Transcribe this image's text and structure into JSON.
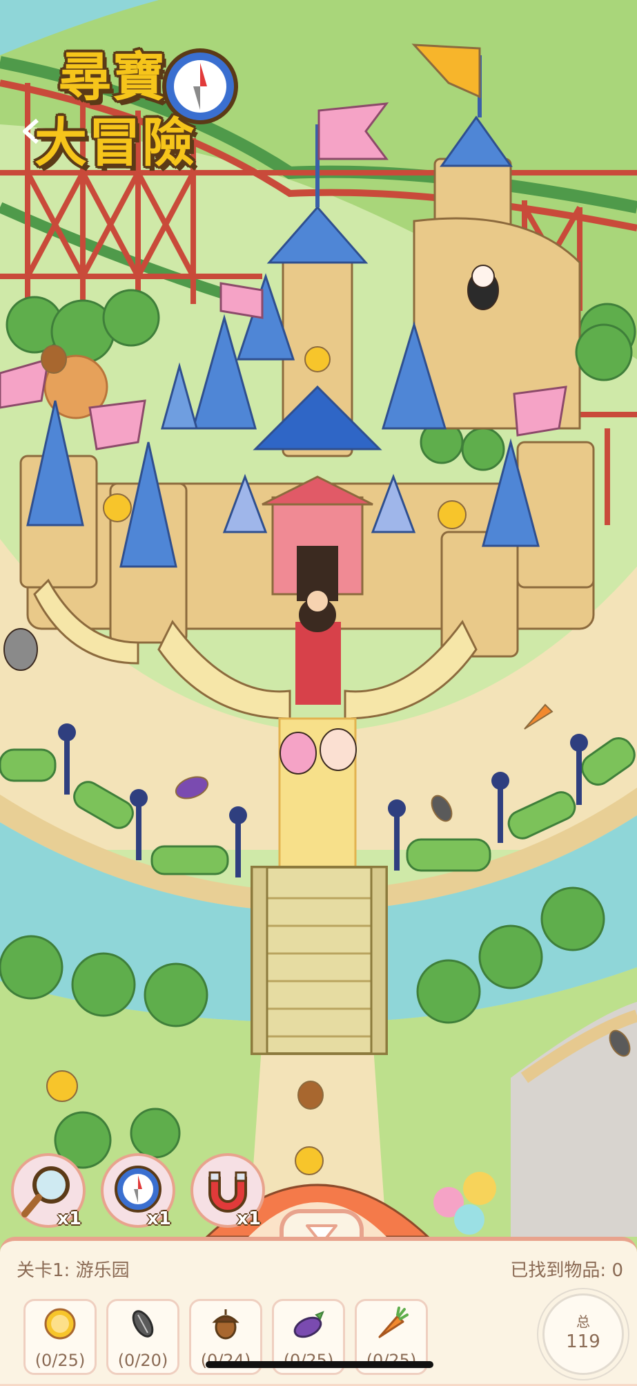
{
  "logo": {
    "line1": "尋寶",
    "line2": "大冒險"
  },
  "tools": [
    {
      "name": "magnifier",
      "count": "x1"
    },
    {
      "name": "compass",
      "count": "x1"
    },
    {
      "name": "magnet",
      "count": "x1"
    }
  ],
  "panel": {
    "level": "关卡1: 游乐园",
    "found": "已找到物品: 0",
    "items": [
      {
        "icon": "coin-icon",
        "progress": "(0/25)"
      },
      {
        "icon": "sunflower-seed-icon",
        "progress": "(0/20)"
      },
      {
        "icon": "acorn-icon",
        "progress": "(0/24)"
      },
      {
        "icon": "eggplant-icon",
        "progress": "(0/25)"
      },
      {
        "icon": "carrot-icon",
        "progress": "(0/25)"
      }
    ],
    "total_label": "总",
    "total_value": "119"
  },
  "colors": {
    "grass": "#cfe9a8",
    "water": "#8fd6d8",
    "path": "#f3dca8",
    "panel_border": "#e8a38d"
  }
}
